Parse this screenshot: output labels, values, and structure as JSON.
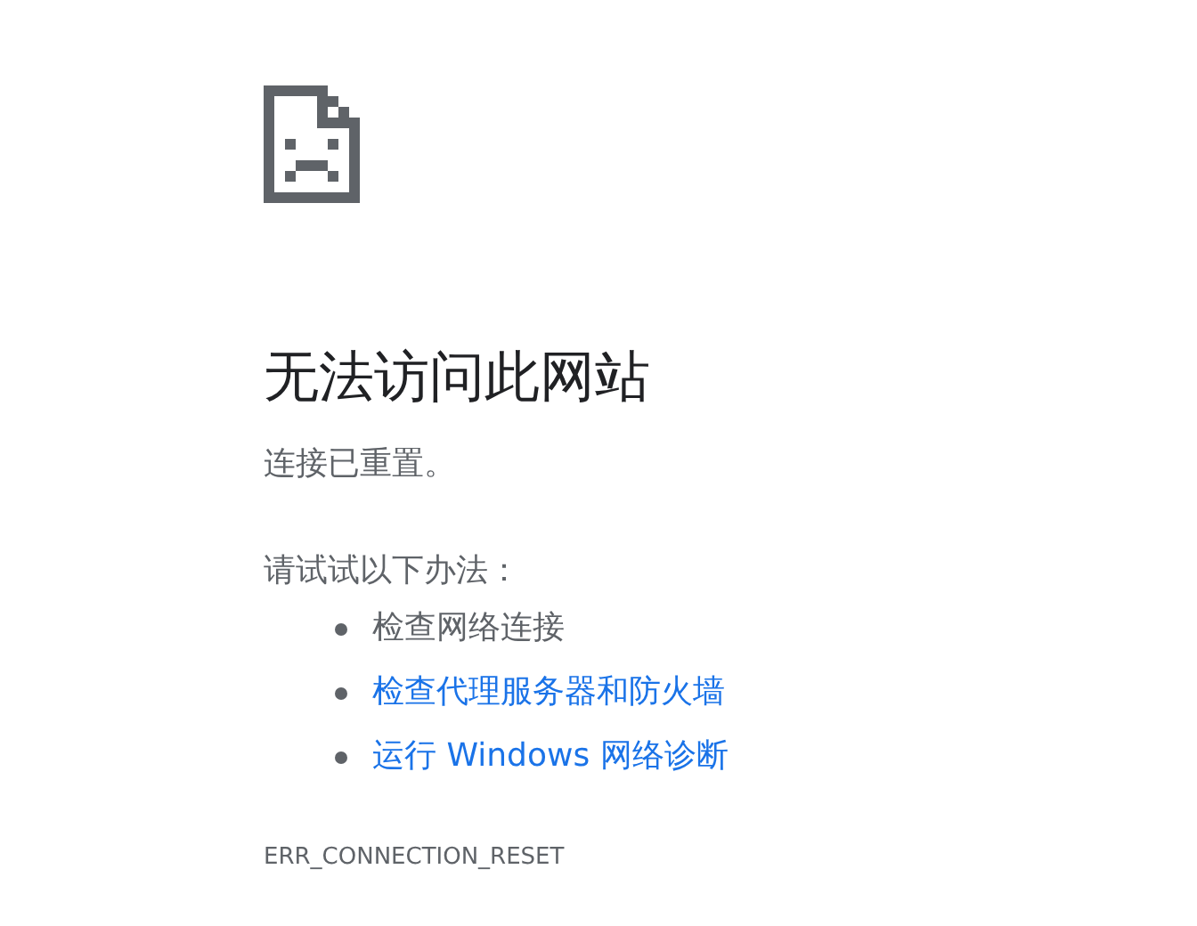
{
  "heading": "无法访问此网站",
  "message": "连接已重置。",
  "suggestions": {
    "label": "请试试以下办法：",
    "items": [
      {
        "kind": "text",
        "text": "检查网络连接"
      },
      {
        "kind": "link",
        "text": "检查代理服务器和防火墙"
      },
      {
        "kind": "link",
        "text": "运行 Windows 网络诊断"
      }
    ]
  },
  "error_code": "ERR_CONNECTION_RESET"
}
